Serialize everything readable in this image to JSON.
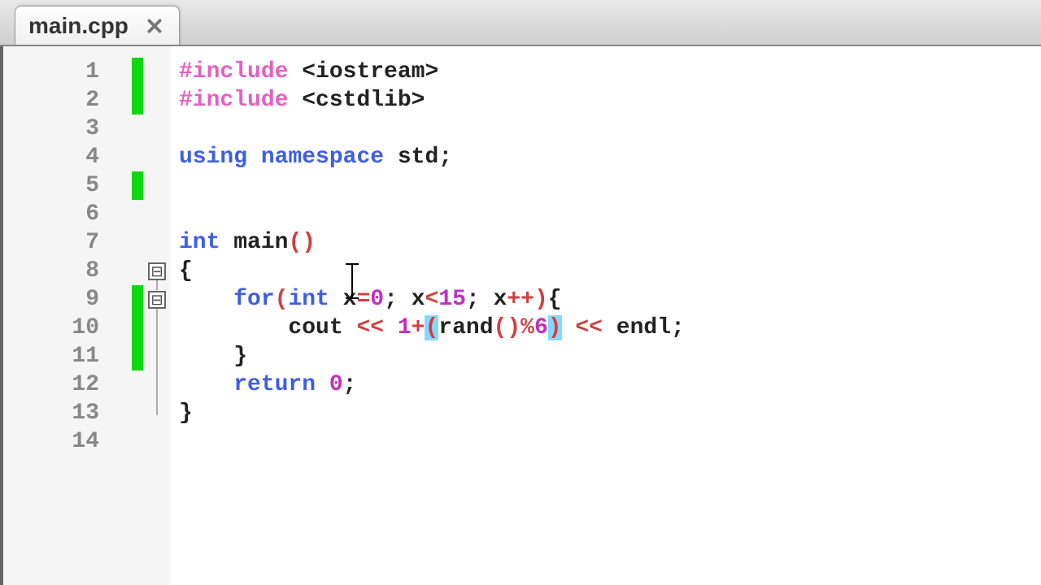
{
  "tab": {
    "title": "main.cpp"
  },
  "lines": {
    "numbers": [
      "1",
      "2",
      "3",
      "4",
      "5",
      "6",
      "7",
      "8",
      "9",
      "10",
      "11",
      "12",
      "13",
      "14"
    ]
  },
  "code": {
    "l1": {
      "directive": "#include ",
      "arg": "<iostream>"
    },
    "l2": {
      "directive": "#include ",
      "arg": "<cstdlib>"
    },
    "l4": {
      "kw_using": "using ",
      "kw_ns": "namespace ",
      "ns": "std",
      "semi": ";"
    },
    "l7": {
      "kw_int": "int ",
      "fn": "main",
      "parens": "()"
    },
    "l8": {
      "brace": "{"
    },
    "l9": {
      "indent": "    ",
      "kw_for": "for",
      "lp": "(",
      "kw_int": "int ",
      "var": "x",
      "eq": "=",
      "zero": "0",
      "semi1": "; ",
      "var2": "x",
      "lt": "<",
      "fifteen": "15",
      "semi2": "; ",
      "var3": "x",
      "inc": "++",
      "rp": ")",
      "lb": "{"
    },
    "l10": {
      "indent": "        ",
      "cout": "cout ",
      "lshift1": "<< ",
      "one": "1",
      "plus": "+",
      "lp": "(",
      "rand": "rand",
      "call": "()",
      "mod": "%",
      "six": "6",
      "rp": ")",
      "sp": " ",
      "lshift2": "<< ",
      "endl": "endl",
      "semi": ";"
    },
    "l11": {
      "indent": "    ",
      "rb": "}"
    },
    "l12": {
      "indent": "    ",
      "kw_return": "return ",
      "zero": "0",
      "semi": ";"
    },
    "l13": {
      "brace": "}"
    }
  },
  "colors": {
    "green_marker": "#10d810",
    "keyword_blue": "#3e5fe0",
    "number_purple": "#c030c0",
    "op_red": "#d04040",
    "bracket_highlight": "#85d8ff"
  }
}
